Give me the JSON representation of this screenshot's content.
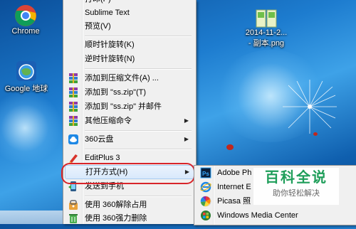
{
  "desktop": {
    "icons": [
      {
        "name": "Chrome",
        "label": "Chrome"
      },
      {
        "name": "Google Earth",
        "label": "Google 地球"
      },
      {
        "name": "image-file",
        "label_line1": "2014-11-2...",
        "label_line2": "- 副本.png"
      }
    ]
  },
  "context_menu": {
    "items": [
      {
        "label": "打印(P)",
        "icon": "none"
      },
      {
        "label": "Sublime Text",
        "icon": "none"
      },
      {
        "label": "预览(V)",
        "icon": "none"
      },
      {
        "label": "顺时针旋转(K)",
        "icon": "none"
      },
      {
        "label": "逆时针旋转(N)",
        "icon": "none"
      },
      {
        "label": "添加到压缩文件(A) ...",
        "icon": "winrar-icon"
      },
      {
        "label": "添加到 \"ss.zip\"(T)",
        "icon": "winrar-icon"
      },
      {
        "label": "添加到 \"ss.zip\" 并邮件",
        "icon": "winrar-icon"
      },
      {
        "label": "其他压缩命令",
        "icon": "winrar-icon",
        "submenu": true
      },
      {
        "label": "360云盘",
        "icon": "cloud-360-icon",
        "submenu": true
      },
      {
        "label": "EditPlus 3",
        "icon": "editplus-icon"
      },
      {
        "label": "打开方式(H)",
        "icon": "none",
        "submenu": true,
        "highlighted": true
      },
      {
        "label": "发送到手机",
        "icon": "phone-send-icon"
      },
      {
        "label": "使用 360解除占用",
        "icon": "unlock-360-icon"
      },
      {
        "label": "使用 360强力删除",
        "icon": "delete-360-icon"
      }
    ]
  },
  "open_with_submenu": {
    "items": [
      {
        "label": "Adobe Ph",
        "icon": "photoshop-icon"
      },
      {
        "label": "Internet E",
        "icon": "ie-icon"
      },
      {
        "label": "Picasa 照",
        "icon": "picasa-icon"
      },
      {
        "label": "Windows Media Center",
        "icon": "wmc-icon"
      }
    ]
  },
  "watermark": {
    "title": "百科全说",
    "subtitle": "助你轻松解决"
  },
  "colors": {
    "highlight_ring": "#d8252a",
    "menu_bg": "#f0f0f0",
    "watermark_green": "#1f9e5a"
  }
}
